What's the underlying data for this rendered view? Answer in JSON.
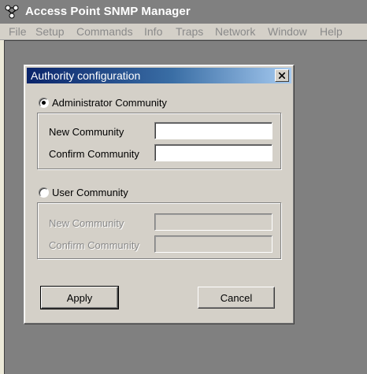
{
  "app": {
    "title": "Access Point SNMP Manager",
    "icon": "network-nodes-icon"
  },
  "menu": [
    "File",
    "Setup",
    "Commands",
    "Info",
    "Traps",
    "Network",
    "Window",
    "Help"
  ],
  "dialog": {
    "title": "Authority configuration",
    "admin": {
      "label": "Administrator Community",
      "selected": true,
      "new_label": "New Community",
      "confirm_label": "Confirm Community",
      "new_value": "",
      "confirm_value": ""
    },
    "user": {
      "label": "User Community",
      "selected": false,
      "new_label": "New Community",
      "confirm_label": "Confirm Community",
      "new_value": "",
      "confirm_value": ""
    },
    "apply_label": "Apply",
    "cancel_label": "Cancel"
  },
  "colors": {
    "title_gradient_start": "#0a246a",
    "title_gradient_end": "#a6caf0",
    "face": "#d4d0c8",
    "workspace": "#808080"
  }
}
